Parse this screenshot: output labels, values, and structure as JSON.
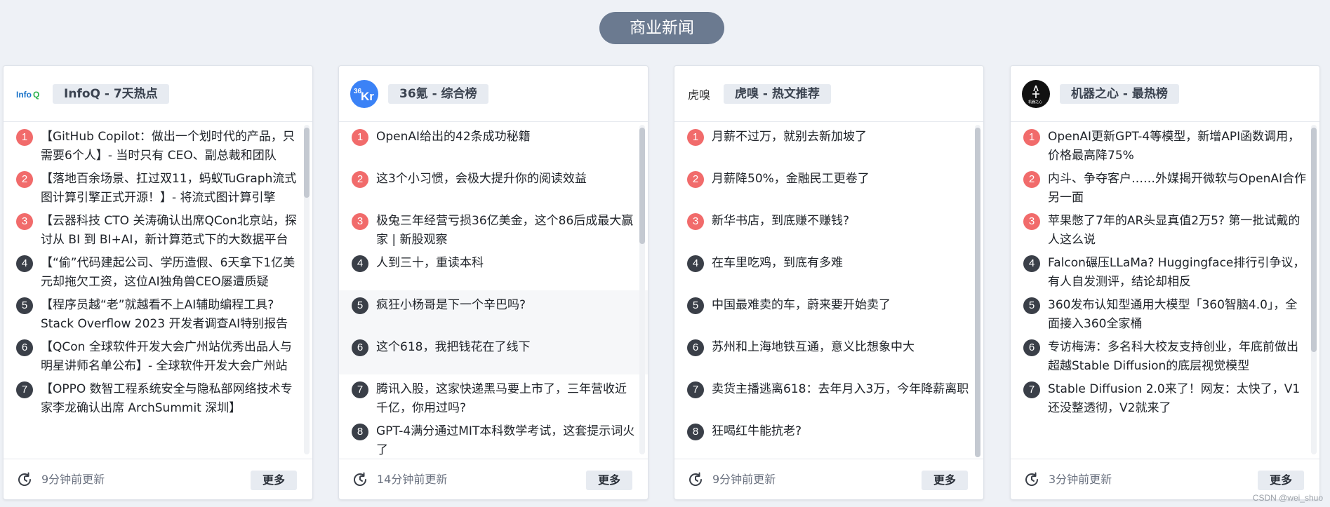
{
  "section_title": "商业新闻",
  "watermark": "CSDN @wei_shuo",
  "colors": {
    "pill": "#6b7a90",
    "rank_top": "#f16b6b",
    "rank_rest": "#3a3f48",
    "infoq_blue": "#1a73c9",
    "kr36_blue": "#3b82f6"
  },
  "more_label": "更多",
  "cards": [
    {
      "logo_icon": "infoq-logo",
      "logo_text": "InfoQ",
      "title": "InfoQ - 7天热点",
      "updated": "9分钟前更新",
      "items": [
        {
          "rank": "1",
          "text": "【GitHub Copilot：做出一个划时代的产品，只需要6个人】- 当时只有 CEO、副总裁和团队"
        },
        {
          "rank": "2",
          "text": "【落地百余场景、扛过双11，蚂蚁TuGraph流式图计算引擎正式开源！】- 将流式图计算引擎"
        },
        {
          "rank": "3",
          "text": "【云器科技 CTO 关涛确认出席QCon北京站，探讨从 BI 到 BI+AI，新计算范式下的大数据平台"
        },
        {
          "rank": "4",
          "text": "【“偷”代码建起公司、学历造假、6天拿下1亿美元却拖欠工资，这位AI独角兽CEO屡遭质疑"
        },
        {
          "rank": "5",
          "text": "【程序员越“老”就越看不上AI辅助编程工具? Stack Overflow 2023 开发者调查AI特别报告"
        },
        {
          "rank": "6",
          "text": "【QCon 全球软件开发大会广州站优秀出品人与明星讲师名单公布】- 全球软件开发大会广州站"
        },
        {
          "rank": "7",
          "text": "【OPPO 数智工程系统安全与隐私部网络技术专家李龙确认出席 ArchSummit 深圳】"
        }
      ]
    },
    {
      "logo_icon": "36kr-logo",
      "logo_text": "36Kr",
      "title": "36氪 - 综合榜",
      "updated": "14分钟前更新",
      "items": [
        {
          "rank": "1",
          "text": "OpenAI给出的42条成功秘籍"
        },
        {
          "rank": "2",
          "text": "这3个小习惯，会极大提升你的阅读效益"
        },
        {
          "rank": "3",
          "text": "极兔三年经营亏损36亿美金，这个86后成最大赢家 | 新股观察"
        },
        {
          "rank": "4",
          "text": "人到三十，重读本科"
        },
        {
          "rank": "5",
          "text": "疯狂小杨哥是下一个辛巴吗?"
        },
        {
          "rank": "6",
          "text": "这个618，我把钱花在了线下"
        },
        {
          "rank": "7",
          "text": "腾讯入股，这家快递黑马要上市了，三年营收近千亿，你用过吗?"
        },
        {
          "rank": "8",
          "text": "GPT-4满分通过MIT本科数学考试，这套提示词火了"
        }
      ]
    },
    {
      "logo_icon": "huxiu-logo",
      "logo_text": "虎嗅",
      "title": "虎嗅 - 热文推荐",
      "updated": "9分钟前更新",
      "items": [
        {
          "rank": "1",
          "text": "月薪不过万，就别去新加坡了"
        },
        {
          "rank": "2",
          "text": "月薪降50%，金融民工更卷了"
        },
        {
          "rank": "3",
          "text": "新华书店，到底赚不赚钱?"
        },
        {
          "rank": "4",
          "text": "在车里吃鸡，到底有多难"
        },
        {
          "rank": "5",
          "text": "中国最难卖的车，蔚来要开始卖了"
        },
        {
          "rank": "6",
          "text": "苏州和上海地铁互通，意义比想象中大"
        },
        {
          "rank": "7",
          "text": "卖货主播逃离618：去年月入3万，今年降薪离职"
        },
        {
          "rank": "8",
          "text": "狂喝红牛能抗老?"
        }
      ]
    },
    {
      "logo_icon": "jiqizhixin-logo",
      "logo_text": "机器之心",
      "title": "机器之心 - 最热榜",
      "updated": "3分钟前更新",
      "items": [
        {
          "rank": "1",
          "text": "OpenAI更新GPT-4等模型，新增API函数调用，价格最高降75%"
        },
        {
          "rank": "2",
          "text": "内斗、争夺客户……外媒揭开微软与OpenAI合作另一面"
        },
        {
          "rank": "3",
          "text": "苹果憋了7年的AR头显真值2万5? 第一批试戴的人这么说"
        },
        {
          "rank": "4",
          "text": "Falcon碾压LLaMa? Huggingface排行引争议，有人自发测评，结论却相反"
        },
        {
          "rank": "5",
          "text": "360发布认知型通用大模型「360智脑4.0」，全面接入360全家桶"
        },
        {
          "rank": "6",
          "text": "专访梅涛：多名科大校友支持创业，年底前做出超越Stable Diffusion的底层视觉模型"
        },
        {
          "rank": "7",
          "text": "Stable Diffusion 2.0来了！网友：太快了，V1还没整透彻，V2就来了"
        }
      ]
    }
  ]
}
